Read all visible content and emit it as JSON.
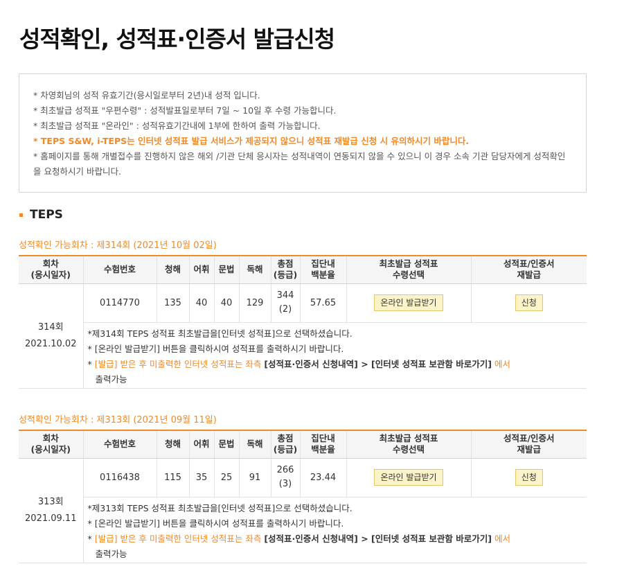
{
  "page": {
    "title": "성적확인, 성적표·인증서 발급신청"
  },
  "notice": {
    "lines": [
      "* 차영회님의 성적 유효기간(응시일로부터 2년)내 성적 입니다.",
      "* 최초발급 성적표 \"우편수령\" : 성적발표일로부터 7일 ~ 10일 후 수령 가능합니다.",
      "* 최초발급 성적표 \"온라인\" : 성적유효기간내에 1부에 한하여 출력 가능합니다.",
      "* TEPS S&W, i-TEPS는 인터넷 성적표 발급 서비스가 제공되지 않으니 성적표 재발급 신청 시 유의하시기 바랍니다.",
      "* 홈페이지를 통해 개별접수를 진행하지 않은 해외 /기관 단체 응시자는 성적내역이 연동되지 않을 수 있으니 이 경우 소속 기관 담당자에게 성적확인을 요청하시기 바랍니다."
    ]
  },
  "section": {
    "title": "TEPS"
  },
  "table_headers": {
    "round": "회차",
    "round_sub": "(응시일자)",
    "exam_no": "수험번호",
    "listening": "청해",
    "vocab": "어휘",
    "grammar": "문법",
    "reading": "독해",
    "total": "총점",
    "total_sub": "(등급)",
    "percentile": "집단내",
    "percentile_sub": "백분율",
    "first_issue": "최초발급 성적표",
    "first_issue_sub": "수령선택",
    "reissue": "성적표/인증서",
    "reissue_sub": "재발급"
  },
  "rounds": [
    {
      "caption": "성적확인 가능회차 : 제314회 (2021년 10월 02일)",
      "round": "314회",
      "date": "2021.10.02",
      "exam_no": "0114770",
      "listening": "135",
      "vocab": "40",
      "grammar": "40",
      "reading": "129",
      "total": "344",
      "grade": "(2)",
      "percentile": "57.65",
      "online_button": "온라인 발급받기",
      "apply_button": "신청",
      "msg1": "*제314회 TEPS 성적표 최초발급을[인터넷 성적표]으로 선택하셨습니다.",
      "msg2": "* [온라인 발급받기] 버튼을 클릭하시여 성적표를 출력하시기 바랍니다.",
      "msg3_star": "* ",
      "msg3_orange1": "[발급] 받은 후 미출력한 인터넷 성적표는 좌측 ",
      "msg3_bold": "[성적표·인증서 신청내역] > [인터넷 성적표 보관함 바로가기]",
      "msg3_orange2": " 에서",
      "msg3_orange3": "출력가능"
    },
    {
      "caption": "성적확인 가능회차 : 제313회 (2021년 09월 11일)",
      "round": "313회",
      "date": "2021.09.11",
      "exam_no": "0116438",
      "listening": "115",
      "vocab": "35",
      "grammar": "25",
      "reading": "91",
      "total": "266",
      "grade": "(3)",
      "percentile": "23.44",
      "online_button": "온라인 발급받기",
      "apply_button": "신청",
      "msg1": "*제313회 TEPS 성적표 최초발급을[인터넷 성적표]으로 선택하셨습니다.",
      "msg2": "* [온라인 발급받기] 버튼을 클릭하시여 성적표를 출력하시기 바랍니다.",
      "msg3_star": "* ",
      "msg3_orange1": "[발급] 받은 후 미출력한 인터넷 성적표는 좌측 ",
      "msg3_bold": "[성적표·인증서 신청내역] > [인터넷 성적표 보관함 바로가기]",
      "msg3_orange2": " 에서",
      "msg3_orange3": "출력가능"
    }
  ],
  "colors": {
    "accent": "#ef8a27",
    "button_bg": "#fdf3c8",
    "button_border": "#e7c46a"
  }
}
